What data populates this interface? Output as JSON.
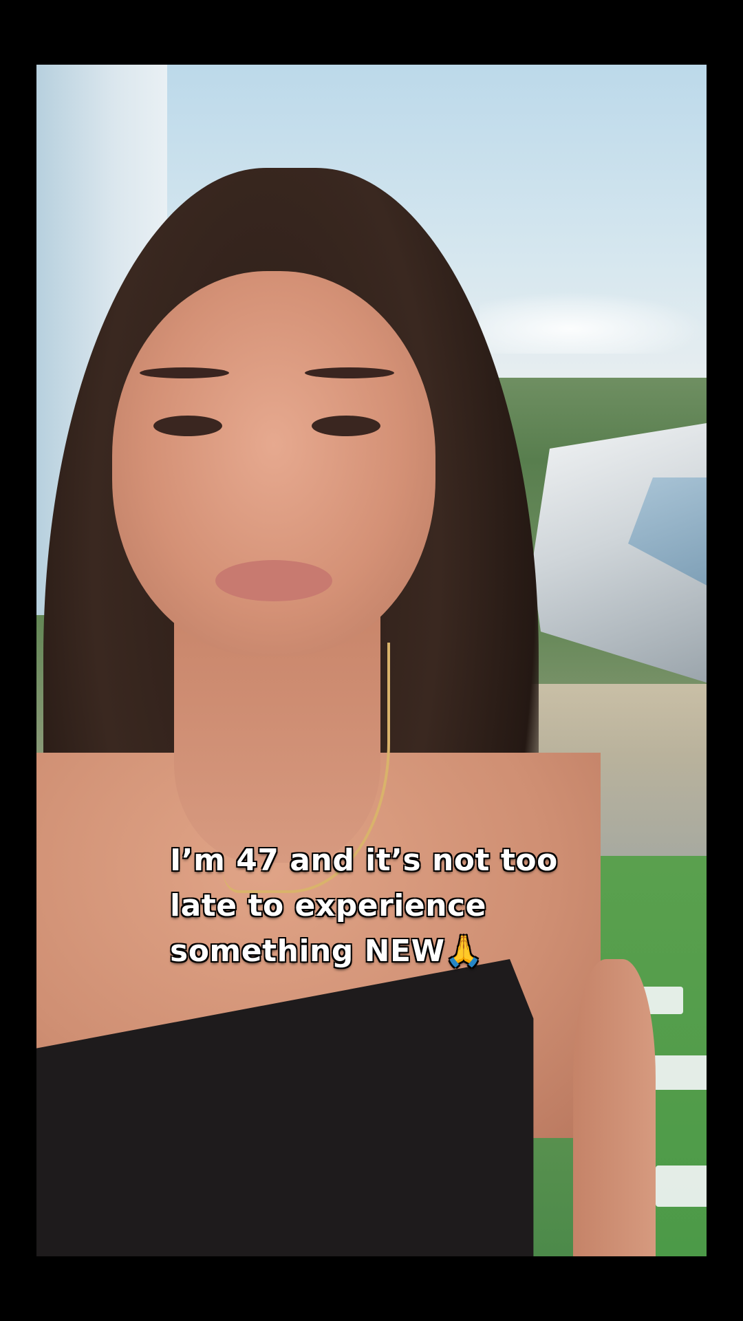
{
  "video": {
    "caption_lines": [
      "I’m 47 and it’s not too",
      "late to experience",
      "something NEW🙏"
    ]
  }
}
